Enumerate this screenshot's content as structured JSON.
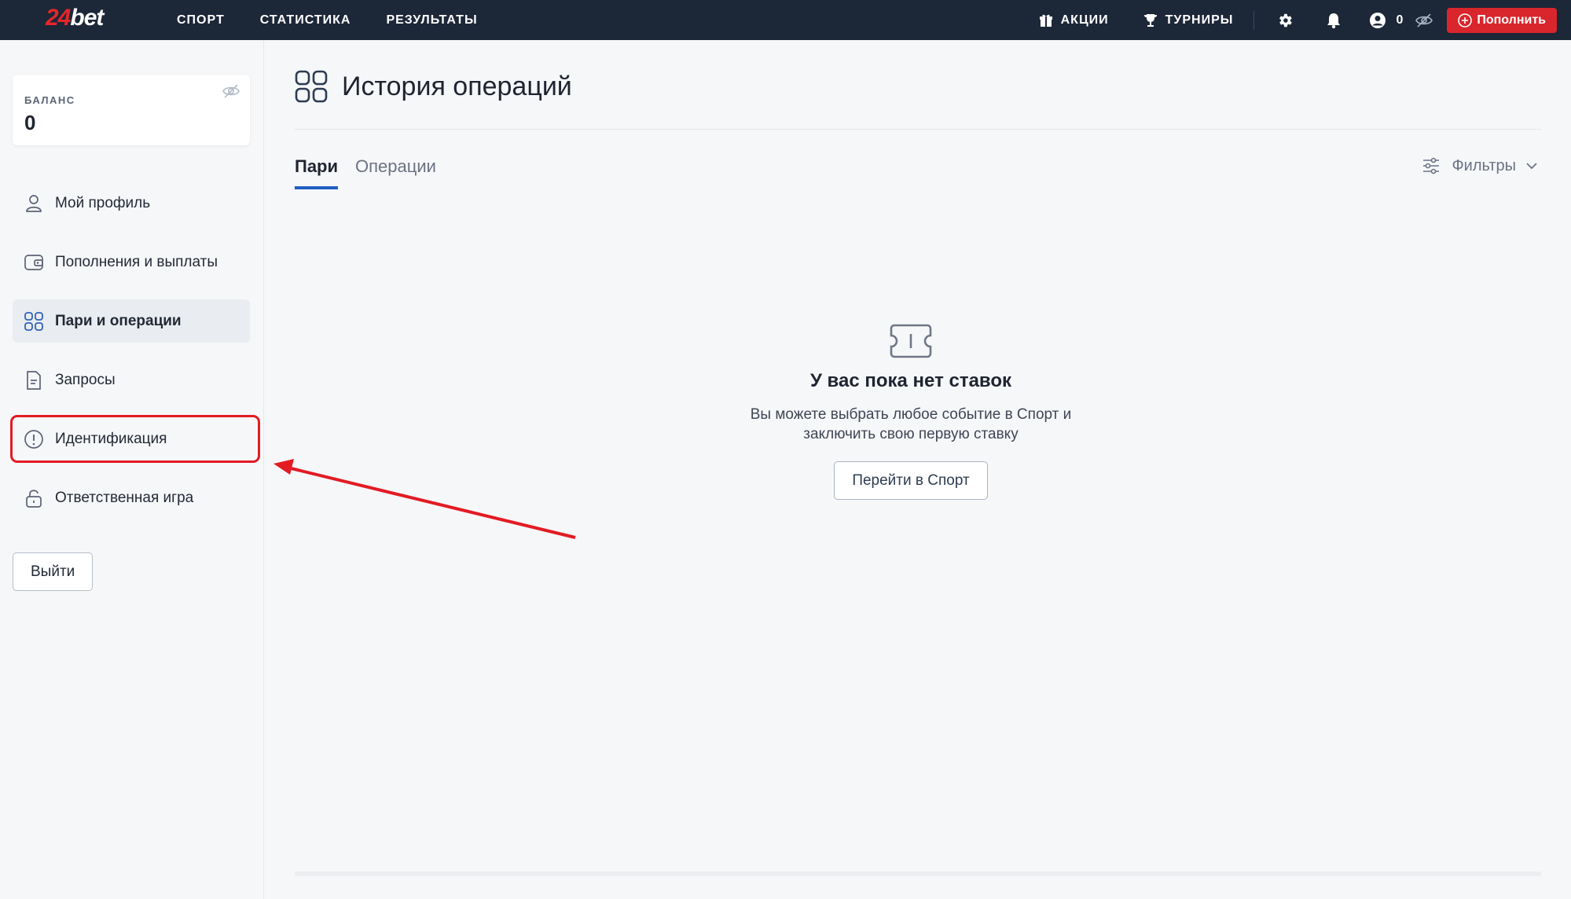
{
  "colors": {
    "topbar": "#1c2738",
    "accent_red": "#d8262c",
    "tab_underline": "#1f5fc2",
    "annotation": "#e31b23"
  },
  "header": {
    "logo_num": "24",
    "logo_bet": "bet",
    "nav": [
      "СПОРТ",
      "СТАТИСТИКА",
      "РЕЗУЛЬТАТЫ"
    ],
    "promo_label": "АКЦИИ",
    "tournaments_label": "ТУРНИРЫ",
    "balance": "0",
    "deposit_label": "Пополнить",
    "icons": [
      "gift-icon",
      "trophy-icon",
      "gear-icon",
      "bell-icon",
      "user-circle-icon",
      "eye-off-icon",
      "plus-circle-icon"
    ]
  },
  "sidebar": {
    "balance_label": "БАЛАНС",
    "balance_value": "0",
    "items": [
      {
        "label": "Мой профиль",
        "icon": "user-icon"
      },
      {
        "label": "Пополнения и выплаты",
        "icon": "wallet-icon"
      },
      {
        "label": "Пари и операции",
        "icon": "grid-icon",
        "active": true
      },
      {
        "label": "Запросы",
        "icon": "document-icon"
      },
      {
        "label": "Идентификация",
        "icon": "alert-circle-icon",
        "highlighted": true
      },
      {
        "label": "Ответственная игра",
        "icon": "lock-icon"
      }
    ],
    "logout_label": "Выйти"
  },
  "main": {
    "title": "История операций",
    "tabs": [
      {
        "label": "Пари",
        "active": true
      },
      {
        "label": "Операции",
        "active": false
      }
    ],
    "filters_label": "Фильтры",
    "empty": {
      "title": "У вас пока нет ставок",
      "text_line1": "Вы можете выбрать любое событие в Спорт и",
      "text_line2": "заключить свою первую ставку",
      "button_label": "Перейти в Спорт"
    }
  }
}
